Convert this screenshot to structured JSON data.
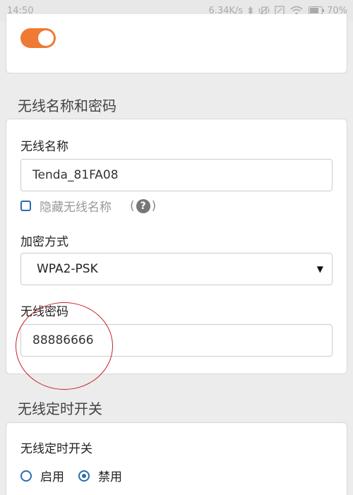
{
  "status_bar": {
    "time": "14:50",
    "net_speed": "6.34K/s",
    "battery": "70%"
  },
  "wireless_toggle": {
    "on": true
  },
  "section_name_password": {
    "title": "无线名称和密码"
  },
  "ssid": {
    "label": "无线名称",
    "value": "Tenda_81FA08"
  },
  "hide_ssid": {
    "label": "隐藏无线名称",
    "checked": false
  },
  "encryption": {
    "label": "加密方式",
    "selected": "WPA2-PSK"
  },
  "password": {
    "label": "无线密码",
    "value": "88886666"
  },
  "section_timer": {
    "title": "无线定时开关"
  },
  "timer": {
    "label": "无线定时开关",
    "options": [
      "启用",
      "禁用"
    ],
    "selected": "禁用"
  },
  "colors": {
    "accent": "#ee7a33",
    "checkbox_border": "#2a6cb0",
    "annotation": "#c8202a"
  }
}
